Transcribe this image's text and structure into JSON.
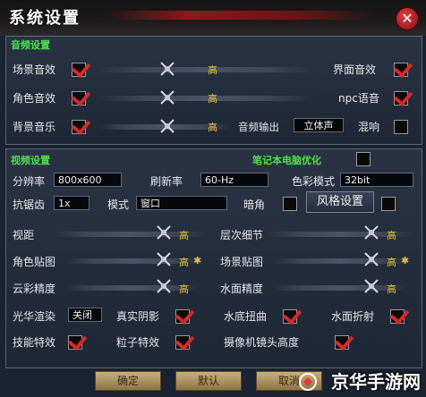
{
  "window": {
    "title": "系统设置",
    "close_icon": "close-icon"
  },
  "audio": {
    "section_title": "音频设置",
    "scene_sound": "场景音效",
    "ui_sound": "界面音效",
    "char_sound": "角色音效",
    "npc_voice": "npc语音",
    "bgm": "背景音乐",
    "output_label": "音频输出",
    "output_value": "立体声",
    "reverb": "混响",
    "level_high": "高"
  },
  "video": {
    "section_title": "视频设置",
    "laptop_opt": "笔记本电脑优化",
    "resolution_label": "分辨率",
    "resolution_value": "800x600",
    "refresh_label": "刷新率",
    "refresh_value": "60-Hz",
    "color_label": "色彩模式",
    "color_value": "32bit",
    "aa_label": "抗锯齿",
    "aa_value": "1x",
    "mode_label": "模式",
    "mode_value": "窗口",
    "vignette": "暗角",
    "style_btn": "风格设置",
    "view_dist": "视距",
    "lod": "层次细节",
    "char_texture": "角色贴图",
    "scene_texture": "场景贴图",
    "cloud": "云彩精度",
    "water_quality": "水面精度",
    "light_label": "光华渲染",
    "light_value": "关闭",
    "real_shadow": "真实阴影",
    "water_distort": "水底扭曲",
    "water_reflect": "水面折射",
    "skill_fx": "技能特效",
    "particle_fx": "粒子特效",
    "camera_height": "摄像机镜头高度",
    "level_high": "高",
    "star": "✱"
  },
  "buttons": {
    "ok": "确定",
    "default": "默认",
    "cancel": "取消"
  },
  "watermark": "京华手游网",
  "colors": {
    "accent_green": "#4be04b",
    "check_red": "#d42a2a",
    "value_yellow": "#e2c13a"
  }
}
